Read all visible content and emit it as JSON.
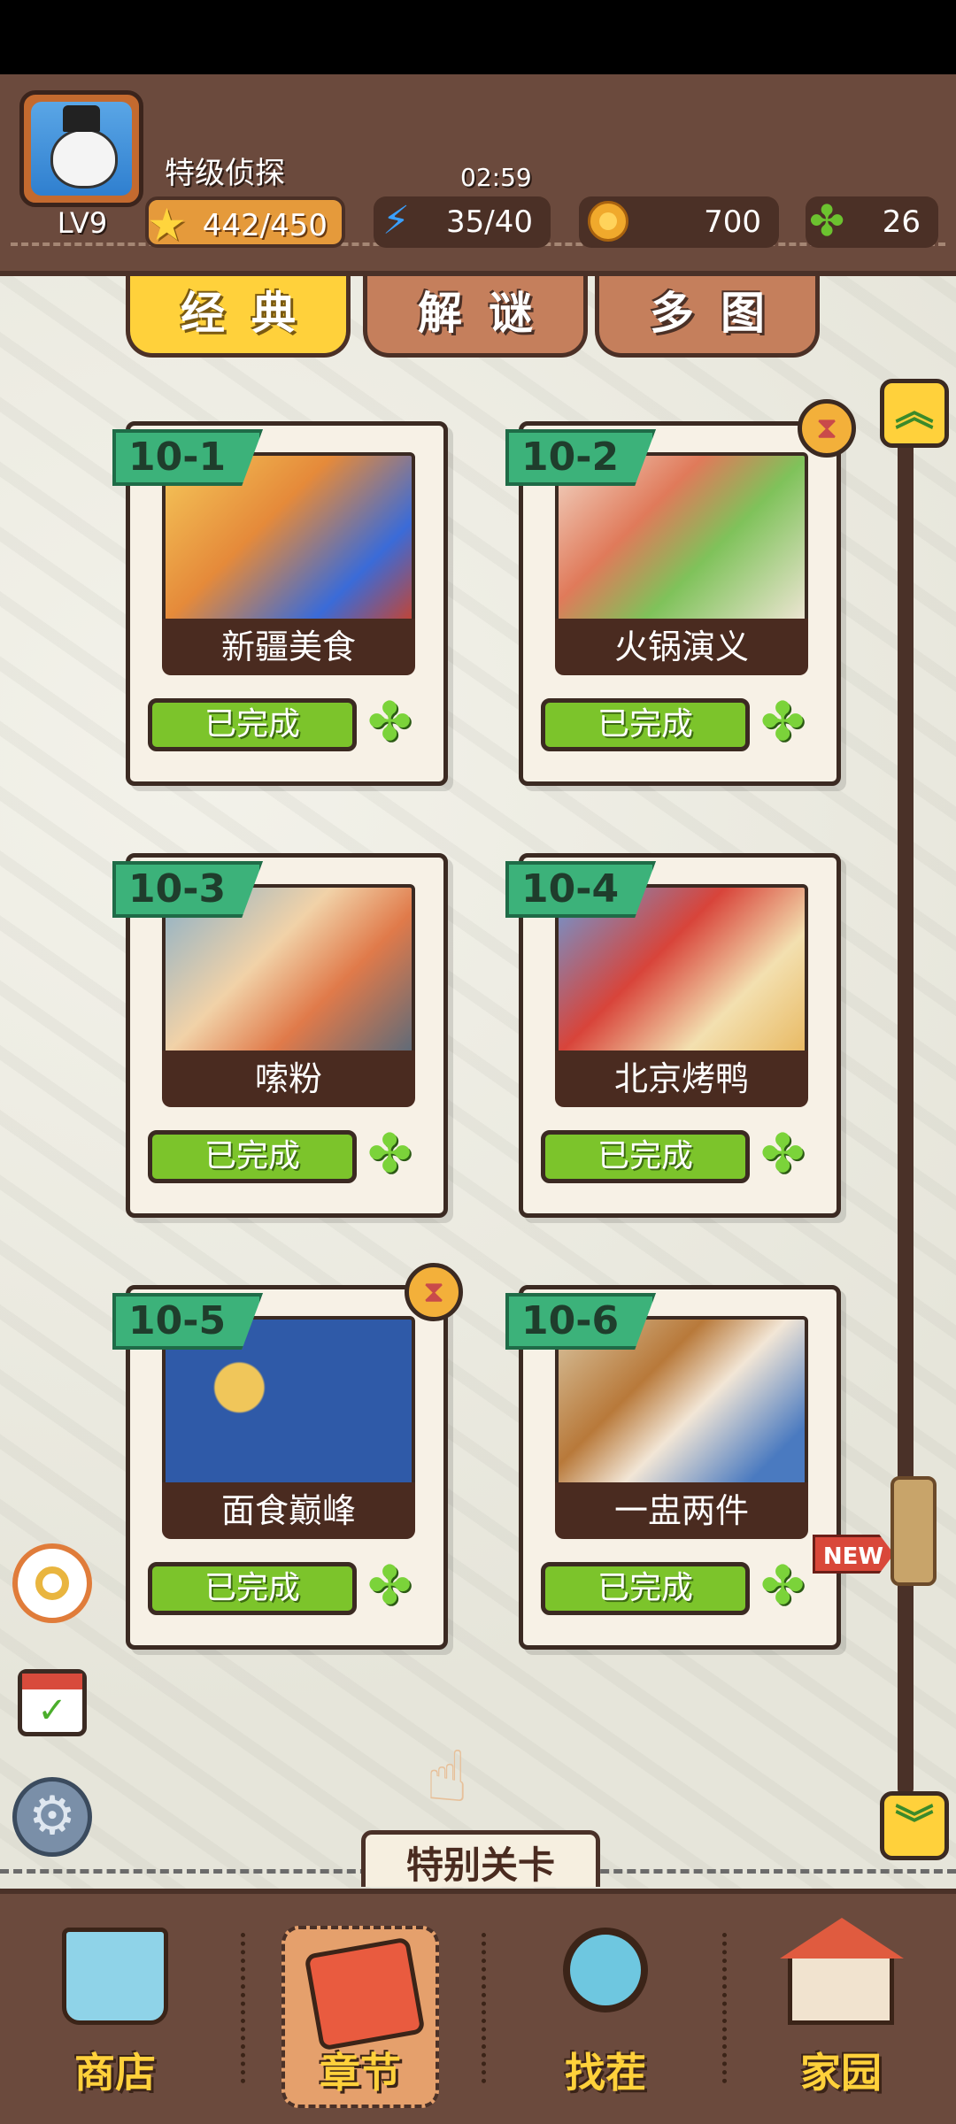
{
  "header": {
    "level": "LV9",
    "title": "特级侦探",
    "timer": "02:59",
    "stars": "442/450",
    "energy": "35/40",
    "coins": "700",
    "clovers": "26"
  },
  "tabs": [
    {
      "label": "经典",
      "active": true
    },
    {
      "label": "解谜",
      "active": false
    },
    {
      "label": "多图",
      "active": false
    }
  ],
  "levels": [
    {
      "id": "10-1",
      "name": "新疆美食",
      "status": "已完成",
      "hourglass": false
    },
    {
      "id": "10-2",
      "name": "火锅演义",
      "status": "已完成",
      "hourglass": true
    },
    {
      "id": "10-3",
      "name": "嗦粉",
      "status": "已完成",
      "hourglass": false
    },
    {
      "id": "10-4",
      "name": "北京烤鸭",
      "status": "已完成",
      "hourglass": false
    },
    {
      "id": "10-5",
      "name": "面食巅峰",
      "status": "已完成",
      "hourglass": true
    },
    {
      "id": "10-6",
      "name": "一盅两件",
      "status": "已完成",
      "hourglass": false
    }
  ],
  "new_tag": "NEW",
  "special_level": "特别关卡",
  "nav": [
    {
      "label": "商店",
      "icon": "cart-icon",
      "active": false
    },
    {
      "label": "章节",
      "icon": "book-icon",
      "active": true
    },
    {
      "label": "找茬",
      "icon": "magnifier-icon",
      "active": false
    },
    {
      "label": "家园",
      "icon": "house-icon",
      "active": false
    }
  ],
  "colors": {
    "accent": "#ffd13b",
    "brown": "#6b4a3d",
    "green": "#7cc42b",
    "badge": "#3cb27a"
  }
}
